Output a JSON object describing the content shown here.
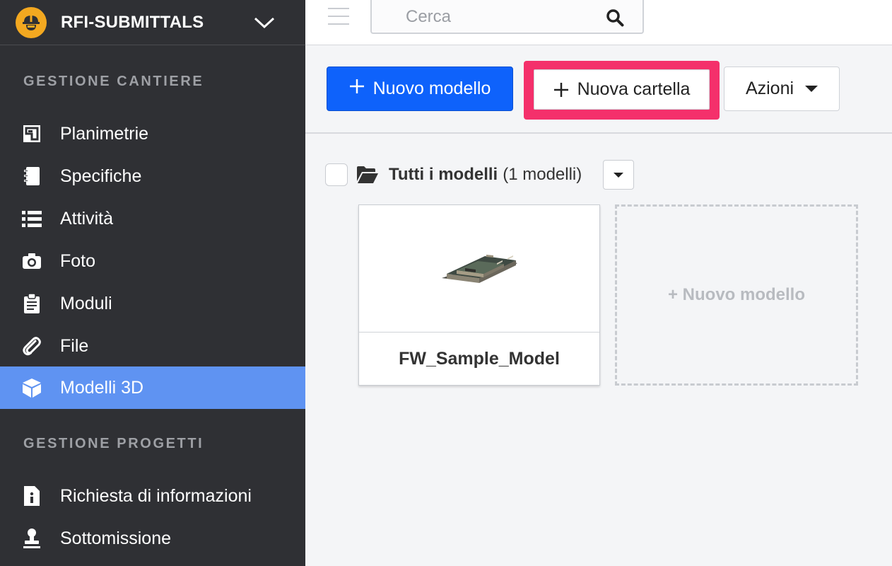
{
  "project": {
    "name": "RFI-SUBMITTALS",
    "logo": "worker-helmet-logo",
    "accent": "#f3a820"
  },
  "sidebar": {
    "sections": [
      {
        "title": "GESTIONE CANTIERE"
      },
      {
        "title": "GESTIONE PROGETTI"
      }
    ],
    "items": [
      {
        "label": "Planimetrie",
        "icon": "blueprint-icon"
      },
      {
        "label": "Specifiche",
        "icon": "notebook-icon"
      },
      {
        "label": "Attività",
        "icon": "list-icon"
      },
      {
        "label": "Foto",
        "icon": "camera-icon"
      },
      {
        "label": "Moduli",
        "icon": "clipboard-icon"
      },
      {
        "label": "File",
        "icon": "paperclip-icon"
      },
      {
        "label": "Modelli 3D",
        "icon": "cube-icon",
        "active": true
      },
      {
        "label": "Richiesta di informazioni",
        "icon": "info-document-icon"
      },
      {
        "label": "Sottomissione",
        "icon": "stamp-icon"
      }
    ],
    "active_color": "#5f93f2"
  },
  "search": {
    "placeholder": "Cerca"
  },
  "toolbar": {
    "new_model_label": "Nuovo modello",
    "new_folder_label": "Nuova cartella",
    "actions_label": "Azioni",
    "primary_color": "#0e62fb",
    "highlight_color": "#f4306b"
  },
  "folder": {
    "title": "Tutti i modelli",
    "count": "(1 modelli)"
  },
  "models": [
    {
      "name": "FW_Sample_Model"
    }
  ],
  "new_model_card": {
    "label": "+ Nuovo modello"
  }
}
